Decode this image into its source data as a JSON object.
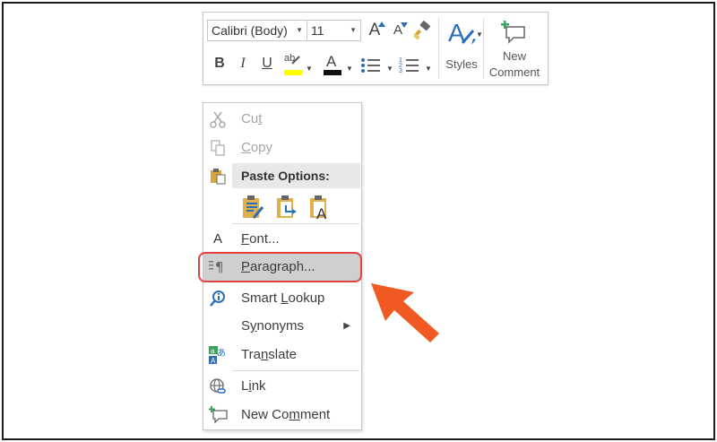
{
  "toolbar": {
    "font_name": "Calibri (Body)",
    "font_size": "11",
    "grow_font": "A",
    "shrink_font": "A",
    "bold": "B",
    "italic": "I",
    "underline": "U",
    "highlight_glyph": "ab",
    "font_color": "A",
    "styles_label": "Styles",
    "new_comment_line1": "New",
    "new_comment_line2": "Comment"
  },
  "menu": {
    "cut": {
      "pre": "Cu",
      "key": "t",
      "post": ""
    },
    "copy": {
      "pre": "",
      "key": "C",
      "post": "opy"
    },
    "paste_options": "Paste Options:",
    "font": {
      "pre": "",
      "key": "F",
      "post": "ont..."
    },
    "paragraph": {
      "pre": "",
      "key": "P",
      "post": "aragraph..."
    },
    "smart_lookup": {
      "pre": "Smart ",
      "key": "L",
      "post": "ookup"
    },
    "synonyms": {
      "pre": "S",
      "key": "y",
      "post": "nonyms"
    },
    "translate": {
      "pre": "Tra",
      "key": "n",
      "post": "slate"
    },
    "link": {
      "pre": "L",
      "key": "i",
      "post": "nk"
    },
    "new_comment": {
      "pre": "New Co",
      "key": "m",
      "post": "ment"
    }
  },
  "colors": {
    "callout": "#e34242",
    "arrow": "#f05a22",
    "highlight_yellow": "#ffff00",
    "icon_blue": "#2a6fb5",
    "icon_green": "#3aa35c"
  },
  "icons": [
    "scissors-icon",
    "copy-icon",
    "paste-icon",
    "paste-keep-formatting-icon",
    "paste-merge-formatting-icon",
    "paste-text-only-icon",
    "font-icon",
    "paragraph-icon",
    "smart-lookup-icon",
    "translate-icon",
    "link-icon",
    "new-comment-icon",
    "format-painter-icon",
    "bullets-icon",
    "numbering-icon",
    "styles-icon"
  ]
}
